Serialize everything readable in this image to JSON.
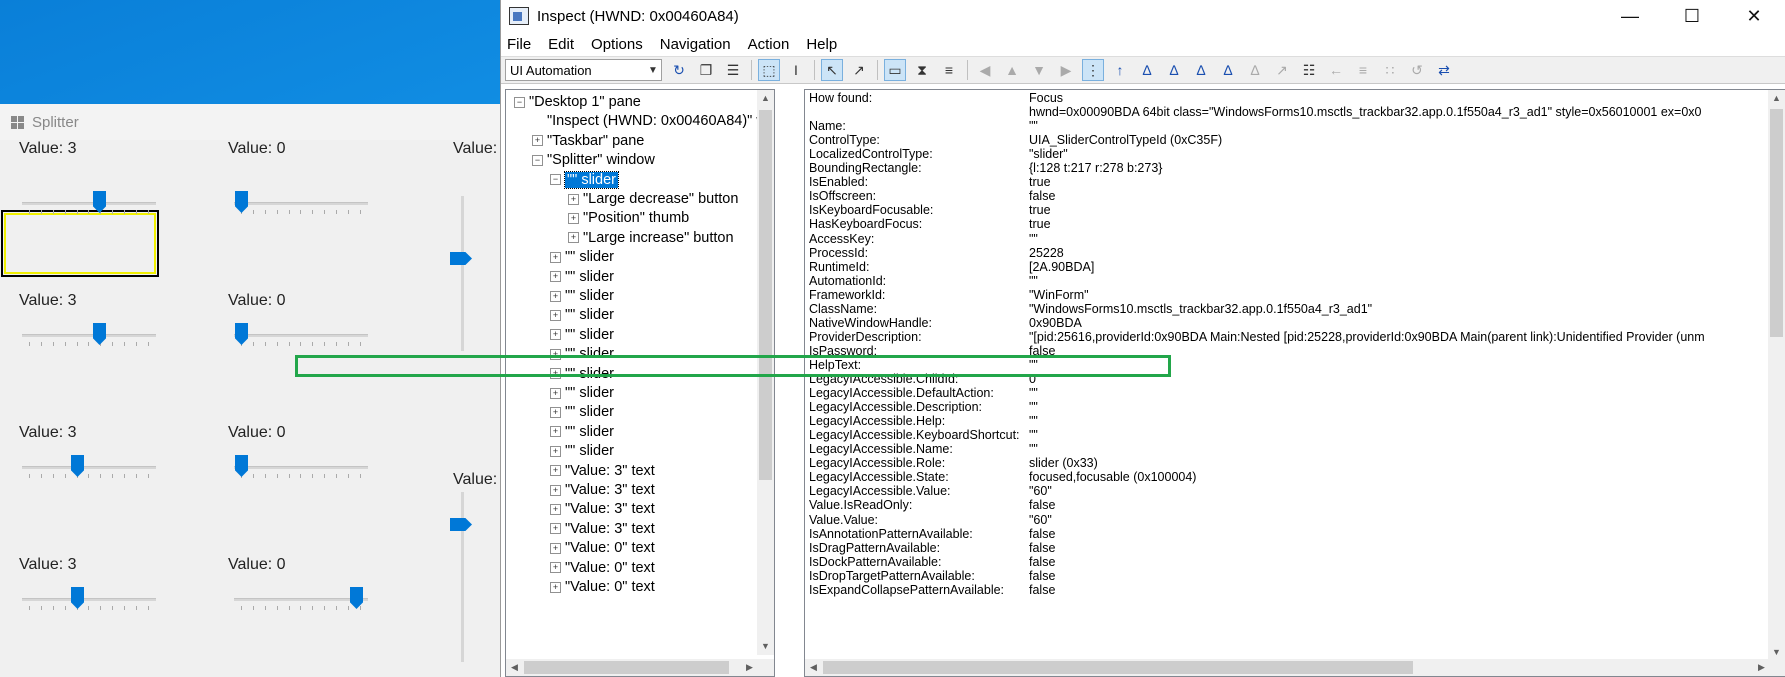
{
  "splitter": {
    "title": "Splitter",
    "labels": [
      {
        "text": "Value: 3"
      },
      {
        "text": "Value: 0"
      },
      {
        "text": "Value:"
      },
      {
        "text": "Value: 3"
      },
      {
        "text": "Value: 0"
      },
      {
        "text": "Value: 3"
      },
      {
        "text": "Value: 0"
      },
      {
        "text": "Value:"
      },
      {
        "text": "Value: 3"
      },
      {
        "text": "Value: 0"
      }
    ]
  },
  "inspect": {
    "title": "Inspect  (HWND: 0x00460A84)",
    "menu": [
      "File",
      "Edit",
      "Options",
      "Navigation",
      "Action",
      "Help"
    ],
    "mode": "UI Automation",
    "tree": [
      {
        "label": "\"Desktop 1\" pane",
        "expander": "minus"
      },
      {
        "label": "\"Inspect  (HWND: 0x00460A84)\" window",
        "expander": ""
      },
      {
        "label": "\"Taskbar\" pane",
        "expander": "plus"
      },
      {
        "label": "\"Splitter\" window",
        "expander": "minus"
      },
      {
        "label": "\"\" slider",
        "expander": "minus",
        "selected": true
      },
      {
        "label": "\"Large decrease\" button",
        "expander": "plus"
      },
      {
        "label": "\"Position\" thumb",
        "expander": "plus"
      },
      {
        "label": "\"Large increase\" button",
        "expander": "plus"
      },
      {
        "label": "\"\" slider",
        "expander": "plus"
      },
      {
        "label": "\"\" slider",
        "expander": "plus"
      },
      {
        "label": "\"\" slider",
        "expander": "plus"
      },
      {
        "label": "\"\" slider",
        "expander": "plus"
      },
      {
        "label": "\"\" slider",
        "expander": "plus"
      },
      {
        "label": "\"\" slider",
        "expander": "plus"
      },
      {
        "label": "\"\" slider",
        "expander": "plus"
      },
      {
        "label": "\"\" slider",
        "expander": "plus"
      },
      {
        "label": "\"\" slider",
        "expander": "plus"
      },
      {
        "label": "\"\" slider",
        "expander": "plus"
      },
      {
        "label": "\"\" slider",
        "expander": "plus"
      },
      {
        "label": "\"Value: 3\" text",
        "expander": "plus"
      },
      {
        "label": "\"Value: 3\" text",
        "expander": "plus"
      },
      {
        "label": "\"Value: 3\" text",
        "expander": "plus"
      },
      {
        "label": "\"Value: 3\" text",
        "expander": "plus"
      },
      {
        "label": "\"Value: 0\" text",
        "expander": "plus"
      },
      {
        "label": "\"Value: 0\" text",
        "expander": "plus"
      },
      {
        "label": "\"Value: 0\" text",
        "expander": "plus"
      }
    ],
    "properties": [
      {
        "k": "How found:",
        "v": "Focus"
      },
      {
        "k": "",
        "v": "hwnd=0x00090BDA 64bit class=\"WindowsForms10.msctls_trackbar32.app.0.1f550a4_r3_ad1\" style=0x56010001 ex=0x0"
      },
      {
        "k": "Name:",
        "v": "\"\""
      },
      {
        "k": "ControlType:",
        "v": "UIA_SliderControlTypeId (0xC35F)"
      },
      {
        "k": "LocalizedControlType:",
        "v": "\"slider\""
      },
      {
        "k": "BoundingRectangle:",
        "v": "{l:128 t:217 r:278 b:273}"
      },
      {
        "k": "IsEnabled:",
        "v": "true"
      },
      {
        "k": "IsOffscreen:",
        "v": "false"
      },
      {
        "k": "IsKeyboardFocusable:",
        "v": "true"
      },
      {
        "k": "HasKeyboardFocus:",
        "v": "true"
      },
      {
        "k": "AccessKey:",
        "v": "\"\""
      },
      {
        "k": "ProcessId:",
        "v": "25228"
      },
      {
        "k": "RuntimeId:",
        "v": "[2A.90BDA]"
      },
      {
        "k": "AutomationId:",
        "v": "\"\""
      },
      {
        "k": "FrameworkId:",
        "v": "\"WinForm\""
      },
      {
        "k": "ClassName:",
        "v": "\"WindowsForms10.msctls_trackbar32.app.0.1f550a4_r3_ad1\""
      },
      {
        "k": "NativeWindowHandle:",
        "v": "0x90BDA"
      },
      {
        "k": "ProviderDescription:",
        "v": "\"[pid:25616,providerId:0x90BDA Main:Nested [pid:25228,providerId:0x90BDA Main(parent link):Unidentified Provider (unm"
      },
      {
        "k": "IsPassword:",
        "v": "false"
      },
      {
        "k": "HelpText:",
        "v": "\"\""
      },
      {
        "k": "LegacyIAccessible.ChildId:",
        "v": "0"
      },
      {
        "k": "LegacyIAccessible.DefaultAction:",
        "v": "\"\""
      },
      {
        "k": "LegacyIAccessible.Description:",
        "v": "\"\""
      },
      {
        "k": "LegacyIAccessible.Help:",
        "v": "\"\""
      },
      {
        "k": "LegacyIAccessible.KeyboardShortcut:",
        "v": "\"\""
      },
      {
        "k": "LegacyIAccessible.Name:",
        "v": "\"\""
      },
      {
        "k": "LegacyIAccessible.Role:",
        "v": "slider (0x33)"
      },
      {
        "k": "LegacyIAccessible.State:",
        "v": "focused,focusable (0x100004)"
      },
      {
        "k": "LegacyIAccessible.Value:",
        "v": "\"60\""
      },
      {
        "k": "Value.IsReadOnly:",
        "v": "false"
      },
      {
        "k": "Value.Value:",
        "v": "\"60\""
      },
      {
        "k": "IsAnnotationPatternAvailable:",
        "v": "false"
      },
      {
        "k": "IsDragPatternAvailable:",
        "v": "false"
      },
      {
        "k": "IsDockPatternAvailable:",
        "v": "false"
      },
      {
        "k": "IsDropTargetPatternAvailable:",
        "v": "false"
      },
      {
        "k": "IsExpandCollapsePatternAvailable:",
        "v": "false"
      }
    ]
  }
}
